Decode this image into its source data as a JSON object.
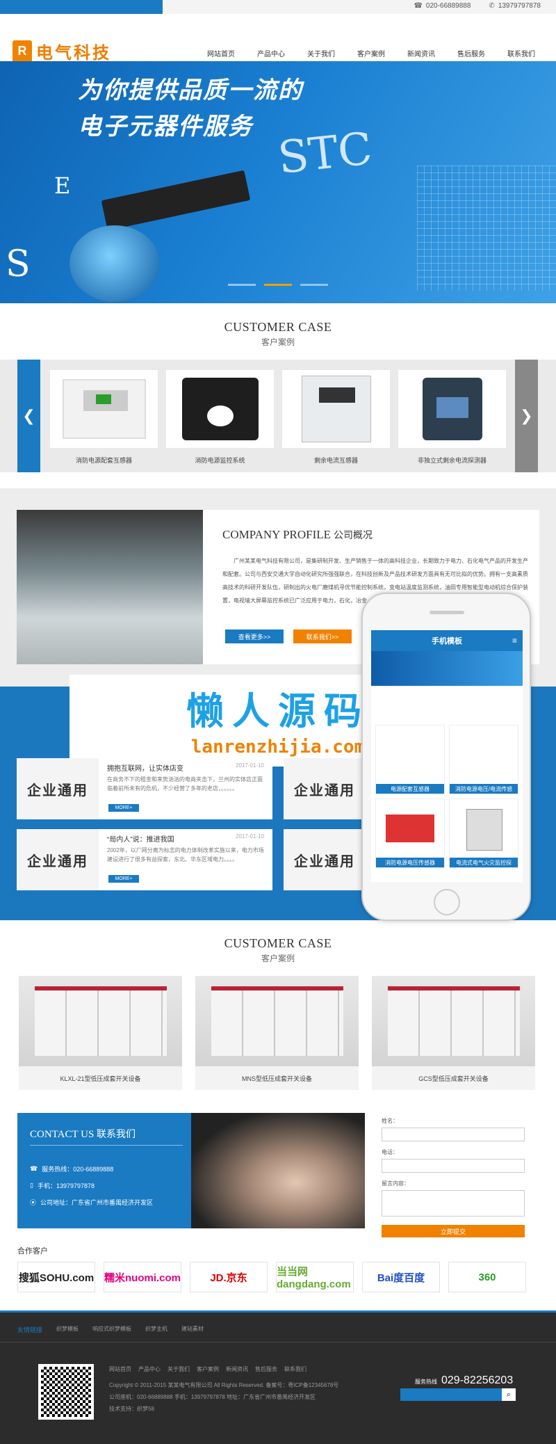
{
  "topbar": {
    "phone": "020-66889888",
    "mobile": "13979797878"
  },
  "header": {
    "logo_mark": "R",
    "logo_text": "电气科技",
    "nav": [
      "网站首页",
      "产品中心",
      "关于我们",
      "客户案例",
      "新闻资讯",
      "售后服务",
      "联系我们"
    ]
  },
  "banner": {
    "line1": "为你提供品质一流的",
    "line2": "电子元器件服务",
    "brand": "STC",
    "letter_e": "E",
    "letter_s": "S"
  },
  "case_section": {
    "title_en": "CUSTOMER CASE",
    "title_cn": "客户案例",
    "items": [
      "消防电源配套互感器",
      "消防电源监控系统",
      "剩余电流互感器",
      "非独立式剩余电流探测器"
    ]
  },
  "profile": {
    "title_en": "COMPANY PROFILE",
    "title_cn": "公司概况",
    "text": "广州某某电气科技有限公司，是集研制开发、生产销售于一体的高科技企业，长期致力于电力、石化电气产品的开发生产和配套。公司与西安交通大学自动化研究所强强联合，在科技创新及产品技术研发方面具有无可比拟的优势。拥有一支高素质高技术的科研开发队伍，研制出的火电厂磨煤机寻优节能控制系统，变电站温度监测系统，油田专用智能型电动机综合保护装置，电视墙大屏幕监控系统已广泛应用于电力，石化，冶金，建材等行业。由公司研制的磨煤机寻优节能……",
    "btn_more": "查看更多>>",
    "btn_contact": "联系我们>>"
  },
  "watermark": {
    "line1": "懒人源码",
    "line2": "lanrenzhijia.com"
  },
  "news": [
    {
      "label": "企业通用",
      "title": "拥抱互联网，让实体店变",
      "date": "2017-01-10",
      "text": "在商务不下的租金和来势汹汹的电商夹击下，兰州的实体店正面临着前所未有的危机，不少经营了多年的老店，。。。。。",
      "more": "MORE+"
    },
    {
      "label": "企业通用",
      "title": "“局内人”说：推进我国",
      "date": "2017-01-10",
      "text": "2002年，以厂网分离为标志的电力体制改革实施以来，电力市场建设进行了很多有益探索，东北、华东区域电力。。。。",
      "more": "MORE+"
    },
    {
      "label": "企业通用"
    },
    {
      "label": "企业通用"
    }
  ],
  "phone": {
    "title": "手机模板",
    "menu_icon": "≡",
    "items": [
      "电源配套互感器",
      "消防电源电压/电流传感",
      "消防电源电压传感器",
      "电流式电气火灾监控探"
    ]
  },
  "case2": {
    "title_en": "CUSTOMER CASE",
    "title_cn": "客户案例",
    "items": [
      "KLXL-21型低压成套开关设备",
      "MNS型低压成套开关设备",
      "GCS型低压成套开关设备"
    ]
  },
  "contact": {
    "title_en": "CONTACT US",
    "title_cn": "联系我们",
    "phone_label": "服务热线：020-66889888",
    "mobile_label": "手机：13979797878",
    "address_label": "公司地址：广东省广州市番禺经济开发区",
    "form": {
      "name": "姓名：",
      "tel": "电话：",
      "msg": "留言内容：",
      "submit": "立即提交"
    }
  },
  "partners": {
    "title": "合作客户",
    "items": [
      "搜狐SOHU.com",
      "糯米nuomi.com",
      "JD.京东",
      "当当网dangdang.com",
      "Bai度百度",
      "360"
    ],
    "colors": [
      "#c00",
      "#e4007f",
      "#d00",
      "#6a3",
      "#2150c8",
      "#2a9d2a"
    ]
  },
  "footer": {
    "links_title": "友情链接",
    "links": [
      "织梦模板",
      "响应式织梦模板",
      "织梦主机",
      "建站素材"
    ],
    "nav": [
      "网站首页",
      "产品中心",
      "关于我们",
      "客户案例",
      "新闻资讯",
      "售后服务",
      "联系我们"
    ],
    "copyright": "Copyright © 2011-2015 某某电气有限公司 All Rights Reserved.    备案号：粤ICP备12345678号",
    "contact": "公司座机：020-66889888    手机：13979797878    地址：广东省广州市番禺经济开发区",
    "support": "技术支持：织梦58",
    "hotline_label": "服务热线",
    "hotline": "029-82256203",
    "search_icon": "magnifier"
  }
}
